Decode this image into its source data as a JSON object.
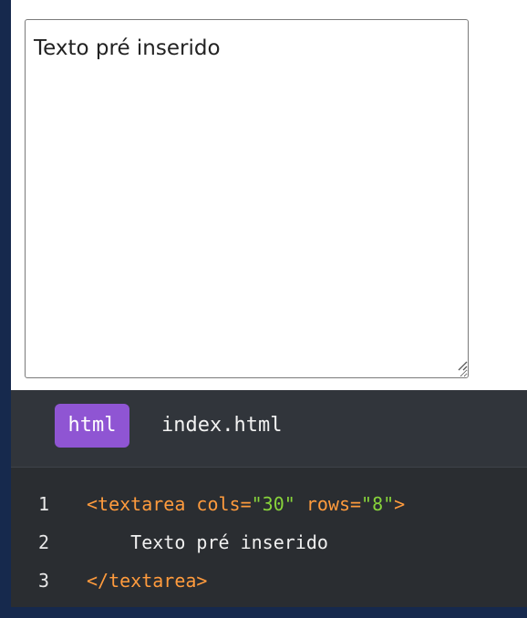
{
  "preview": {
    "textarea_value": "Texto pré inserido"
  },
  "code_block": {
    "language_badge": "html",
    "filename": "index.html",
    "lines": [
      {
        "number": "1",
        "tokens": [
          {
            "text": "<textarea cols=",
            "kind": "tag"
          },
          {
            "text": "\"30\"",
            "kind": "str"
          },
          {
            "text": " rows=",
            "kind": "attr"
          },
          {
            "text": "\"8\"",
            "kind": "str"
          },
          {
            "text": ">",
            "kind": "tag"
          }
        ]
      },
      {
        "number": "2",
        "tokens": [
          {
            "text": "    Texto pré inserido",
            "kind": "plain"
          }
        ]
      },
      {
        "number": "3",
        "tokens": [
          {
            "text": "</textarea>",
            "kind": "tag"
          }
        ]
      }
    ]
  },
  "colors": {
    "page_background": "#16294d",
    "badge": "#8f55d3",
    "tag": "#ff9b3d",
    "string": "#88d43b",
    "code_background": "#2a2d31"
  }
}
